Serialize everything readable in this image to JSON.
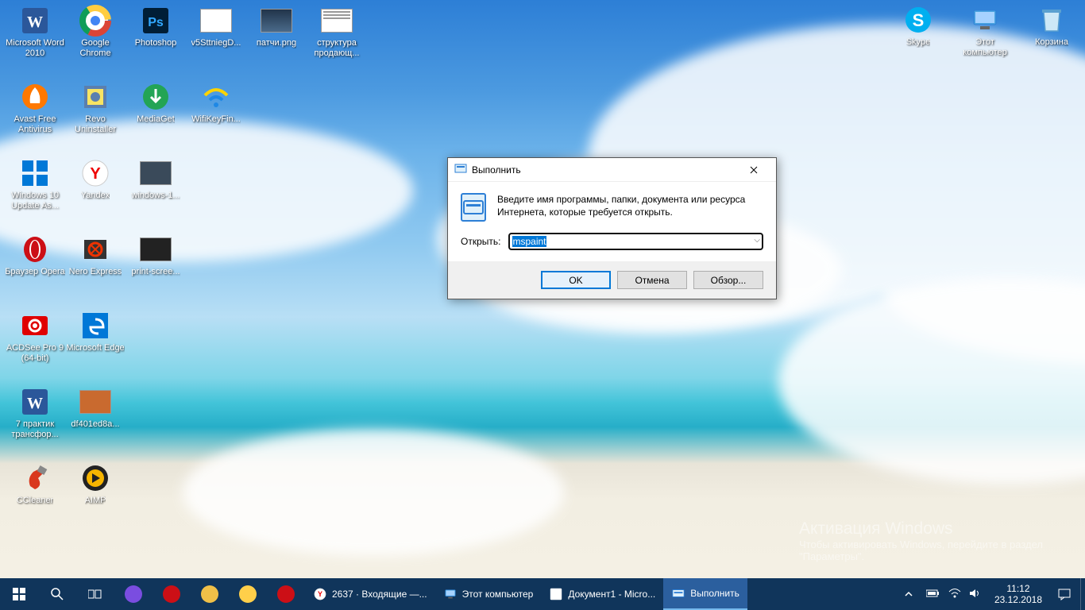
{
  "desktop": {
    "columns": [
      [
        {
          "name": "word-2010",
          "label": "Microsoft Word 2010",
          "icon": "word",
          "color": "#2B579A"
        },
        {
          "name": "avast",
          "label": "Avast Free Antivirus",
          "icon": "avast",
          "color": "#ff7800"
        },
        {
          "name": "win10-update",
          "label": "Windows 10 Update As...",
          "icon": "win-update",
          "color": "#0078d7"
        },
        {
          "name": "opera",
          "label": "Браузер Opera",
          "icon": "opera",
          "color": "#cc0f16"
        },
        {
          "name": "acdsee",
          "label": "ACDSee Pro 9 (64-bit)",
          "icon": "acdsee",
          "color": "#e00000"
        },
        {
          "name": "7praktik",
          "label": "7 практик трансфор...",
          "icon": "wordfile",
          "color": "#2B579A"
        },
        {
          "name": "ccleaner",
          "label": "CCleaner",
          "icon": "ccleaner",
          "color": "#d9381e"
        }
      ],
      [
        {
          "name": "chrome",
          "label": "Google Chrome",
          "icon": "chrome",
          "color": "#fff"
        },
        {
          "name": "revo",
          "label": "Revo Uninstaller",
          "icon": "revo",
          "color": "#5b7fae"
        },
        {
          "name": "yandex",
          "label": "Yandex",
          "icon": "yandex",
          "color": "#fff"
        },
        {
          "name": "nero",
          "label": "Nero Express",
          "icon": "nero",
          "color": "#e30"
        },
        {
          "name": "edge",
          "label": "Microsoft Edge",
          "icon": "edge",
          "color": "#0078d7"
        },
        {
          "name": "df401",
          "label": "df401ed8a...",
          "icon": "thumb",
          "color": "#c96a2f"
        },
        {
          "name": "aimp",
          "label": "AIMP",
          "icon": "aimp",
          "color": "#f7b500"
        }
      ],
      [
        {
          "name": "photoshop",
          "label": "Photoshop",
          "icon": "ps",
          "color": "#001e36"
        },
        {
          "name": "mediaget",
          "label": "MediaGet",
          "icon": "mediaget",
          "color": "#23a455"
        },
        {
          "name": "windows-1",
          "label": "windows-1...",
          "icon": "thumb-dark",
          "color": "#3a4a5a"
        },
        {
          "name": "print-screen",
          "label": "print-scree...",
          "icon": "thumb-dark",
          "color": "#222"
        }
      ],
      [
        {
          "name": "v5stt",
          "label": "v5SttniegD...",
          "icon": "thumb-light",
          "color": "#fff"
        },
        {
          "name": "wifikey",
          "label": "WifiKeyFin...",
          "icon": "wifikey",
          "color": "#ffd400"
        }
      ],
      [
        {
          "name": "patchi",
          "label": "патчи.png",
          "icon": "thumb-photo",
          "color": "#21344a"
        }
      ],
      [
        {
          "name": "struktura",
          "label": "структура продающ...",
          "icon": "thumb-doc",
          "color": "#fff"
        }
      ]
    ],
    "right": [
      {
        "name": "skype",
        "label": "Skype",
        "icon": "skype",
        "color": "#00aff0"
      },
      {
        "name": "this-pc",
        "label": "Этот компьютер",
        "icon": "pc",
        "color": "#a6d2ff"
      },
      {
        "name": "recycle",
        "label": "Корзина",
        "icon": "bin",
        "color": "#cde8f7"
      }
    ]
  },
  "run_dialog": {
    "title": "Выполнить",
    "message": "Введите имя программы, папки, документа или ресурса Интернета, которые требуется открыть.",
    "open_label": "Открыть:",
    "value": "mspaint",
    "ok": "OK",
    "cancel": "Отмена",
    "browse": "Обзор..."
  },
  "activation": {
    "title": "Активация Windows",
    "sub": "Чтобы активировать Windows, перейдите в раздел \"Параметры\"."
  },
  "taskbar": {
    "pinned": [
      {
        "name": "cortana-pill",
        "color": "#7a4de0"
      },
      {
        "name": "opera-tb",
        "color": "#cc0f16"
      },
      {
        "name": "paint-tb",
        "color": "#f0c048"
      },
      {
        "name": "explorer-tb",
        "color": "#ffcf4a"
      },
      {
        "name": "opera2-tb",
        "color": "#cc0f16"
      }
    ],
    "apps": [
      {
        "name": "yandex-mail",
        "label": "2637 · Входящие —...",
        "icon": "yandex",
        "active": false
      },
      {
        "name": "this-pc-tb",
        "label": "Этот компьютер",
        "icon": "pc",
        "active": false
      },
      {
        "name": "word-tb",
        "label": "Документ1 - Micro...",
        "icon": "word",
        "active": false
      },
      {
        "name": "run-tb",
        "label": "Выполнить",
        "icon": "run",
        "active": true
      }
    ],
    "clock_time": "11:12",
    "clock_date": "23.12.2018"
  }
}
